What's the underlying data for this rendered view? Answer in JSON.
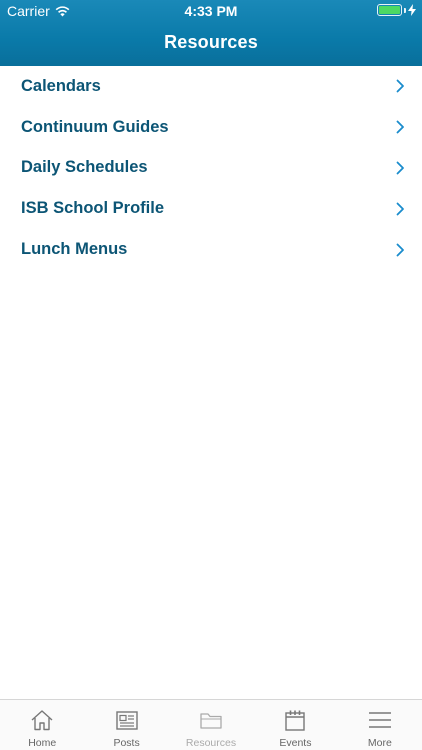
{
  "status_bar": {
    "carrier": "Carrier",
    "time": "4:33 PM",
    "battery_level": 1.0
  },
  "header": {
    "title": "Resources"
  },
  "resources": [
    {
      "label": "Calendars",
      "icon": "chevron-right-icon"
    },
    {
      "label": "Continuum Guides",
      "icon": "chevron-right-icon"
    },
    {
      "label": "Daily Schedules",
      "icon": "chevron-right-icon"
    },
    {
      "label": "ISB School Profile",
      "icon": "chevron-right-icon"
    },
    {
      "label": "Lunch Menus",
      "icon": "chevron-right-icon"
    }
  ],
  "tabbar": {
    "tabs": [
      {
        "label": "Home",
        "icon": "home-icon",
        "active": false
      },
      {
        "label": "Posts",
        "icon": "newspaper-icon",
        "active": false
      },
      {
        "label": "Resources",
        "icon": "folder-icon",
        "active": true
      },
      {
        "label": "Events",
        "icon": "calendar-icon",
        "active": false
      },
      {
        "label": "More",
        "icon": "menu-icon",
        "active": false
      }
    ]
  },
  "colors": {
    "header_bg": "#0a7aa9",
    "row_text": "#0c5575",
    "chevron": "#1a8ccd",
    "battery": "#4cd964"
  }
}
